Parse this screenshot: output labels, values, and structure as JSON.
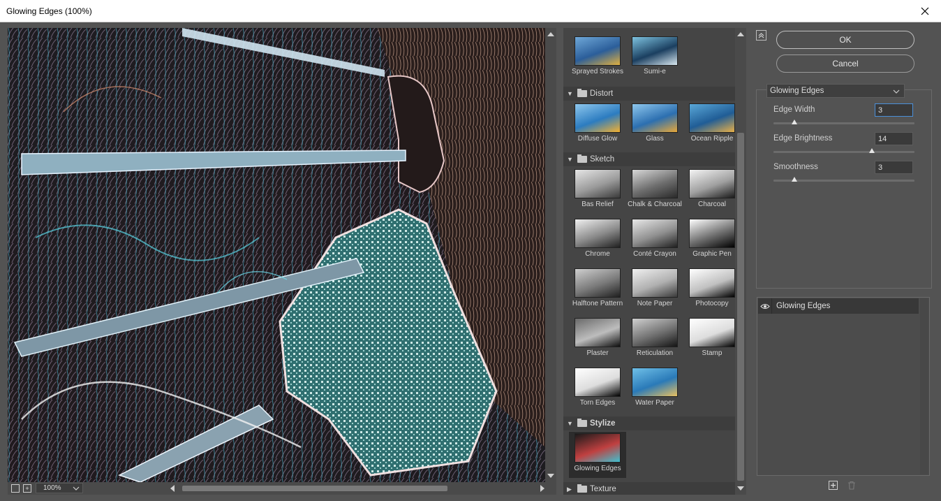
{
  "window": {
    "title": "Glowing Edges (100%)"
  },
  "preview": {
    "zoom": "100%"
  },
  "gallery": {
    "top_items": [
      {
        "label": "Sprayed Strokes",
        "colors": [
          "#6fa8d8",
          "#2b5e9a",
          "#e0b040"
        ]
      },
      {
        "label": "Sumi-e",
        "colors": [
          "#7ec3e0",
          "#1b3f60",
          "#d9e8f0"
        ]
      }
    ],
    "categories": [
      {
        "name": "Distort",
        "expanded": true,
        "items": [
          {
            "label": "Diffuse Glow",
            "colors": [
              "#8fc8ee",
              "#2c7cc0",
              "#f2b030"
            ]
          },
          {
            "label": "Glass",
            "colors": [
              "#8fc8ee",
              "#2c6fb0",
              "#e8a838"
            ]
          },
          {
            "label": "Ocean Ripple",
            "colors": [
              "#5aa8d8",
              "#205d96",
              "#e8b048"
            ]
          }
        ]
      },
      {
        "name": "Sketch",
        "expanded": true,
        "items": [
          {
            "label": "Bas Relief",
            "colors": [
              "#e6e6e6",
              "#9a9a9a",
              "#3a3a3a"
            ]
          },
          {
            "label": "Chalk & Charcoal",
            "colors": [
              "#d8d8d8",
              "#6e6e6e",
              "#2a2a2a"
            ]
          },
          {
            "label": "Charcoal",
            "colors": [
              "#f4f4f4",
              "#a0a0a0",
              "#1a1a1a"
            ]
          },
          {
            "label": "Chrome",
            "colors": [
              "#f0f0f0",
              "#8a8a8a",
              "#202020"
            ]
          },
          {
            "label": "Conté Crayon",
            "colors": [
              "#e8e8e8",
              "#909090",
              "#202020"
            ]
          },
          {
            "label": "Graphic Pen",
            "colors": [
              "#ffffff",
              "#707070",
              "#000000"
            ]
          },
          {
            "label": "Halftone Pattern",
            "colors": [
              "#cfcfcf",
              "#7a7a7a",
              "#202020"
            ]
          },
          {
            "label": "Note Paper",
            "colors": [
              "#f0f0f0",
              "#b0b0b0",
              "#3a3a3a"
            ]
          },
          {
            "label": "Photocopy",
            "colors": [
              "#ffffff",
              "#c0c0c0",
              "#000000"
            ]
          },
          {
            "label": "Plaster",
            "colors": [
              "#6a6a6a",
              "#bdbdbd",
              "#0e0e0e"
            ]
          },
          {
            "label": "Reticulation",
            "colors": [
              "#d0d0d0",
              "#707070",
              "#151515"
            ]
          },
          {
            "label": "Stamp",
            "colors": [
              "#ffffff",
              "#dddddd",
              "#000000"
            ]
          },
          {
            "label": "Torn Edges",
            "colors": [
              "#ffffff",
              "#dddddd",
              "#000000"
            ]
          },
          {
            "label": "Water Paper",
            "colors": [
              "#6fc0e8",
              "#2a7ab8",
              "#e8c060"
            ]
          }
        ]
      },
      {
        "name": "Stylize",
        "expanded": true,
        "items": [
          {
            "label": "Glowing Edges",
            "colors": [
              "#1a1a1a",
              "#c04040",
              "#40c0d0"
            ]
          }
        ]
      },
      {
        "name": "Texture",
        "expanded": false,
        "items": []
      }
    ]
  },
  "buttons": {
    "ok": "OK",
    "cancel": "Cancel"
  },
  "settings": {
    "filter": "Glowing Edges",
    "params": [
      {
        "label": "Edge Width",
        "value": "3",
        "level": 0.15
      },
      {
        "label": "Edge Brightness",
        "value": "14",
        "level": 0.7
      },
      {
        "label": "Smoothness",
        "value": "3",
        "level": 0.15
      }
    ]
  },
  "layers": [
    {
      "name": "Glowing Edges"
    }
  ]
}
